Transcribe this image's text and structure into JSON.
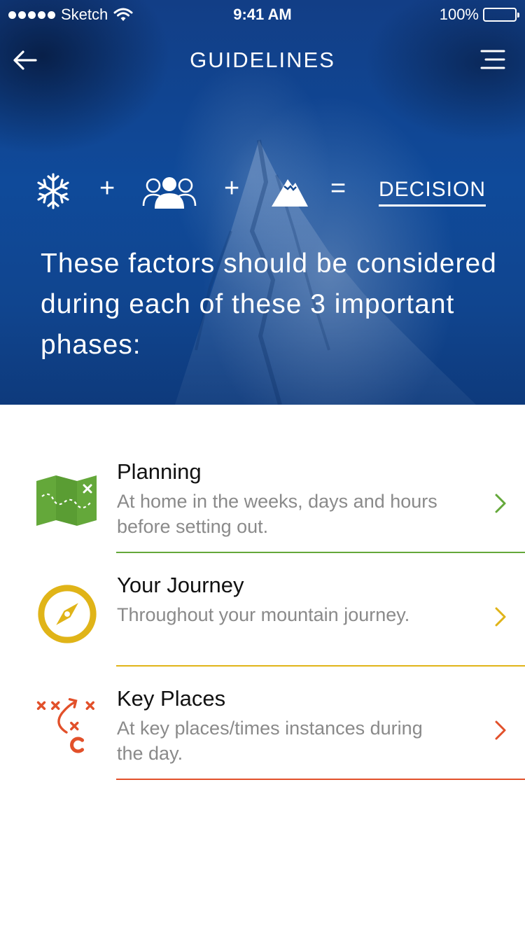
{
  "status_bar": {
    "carrier": "Sketch",
    "time": "9:41 AM",
    "battery": "100%"
  },
  "nav": {
    "title": "GUIDELINES",
    "back_icon": "arrow-left-icon",
    "menu_icon": "hamburger-menu-icon"
  },
  "formula": {
    "icons": [
      "snowflake-icon",
      "group-icon",
      "mountain-icon"
    ],
    "plus": "+",
    "equals": "=",
    "result": "DECISION"
  },
  "intro_text": "These factors should be considered during each of these 3 important phases:",
  "phases": [
    {
      "title": "Planning",
      "description": "At home in the weeks, days and hours before setting out.",
      "icon": "map-icon",
      "color": "#64a83a"
    },
    {
      "title": "Your Journey",
      "description": "Throughout your mountain journey.",
      "icon": "compass-icon",
      "color": "#e0b418"
    },
    {
      "title": "Key Places",
      "description": "At key places/times instances during the day.",
      "icon": "tactics-icon",
      "color": "#e2502a"
    }
  ]
}
